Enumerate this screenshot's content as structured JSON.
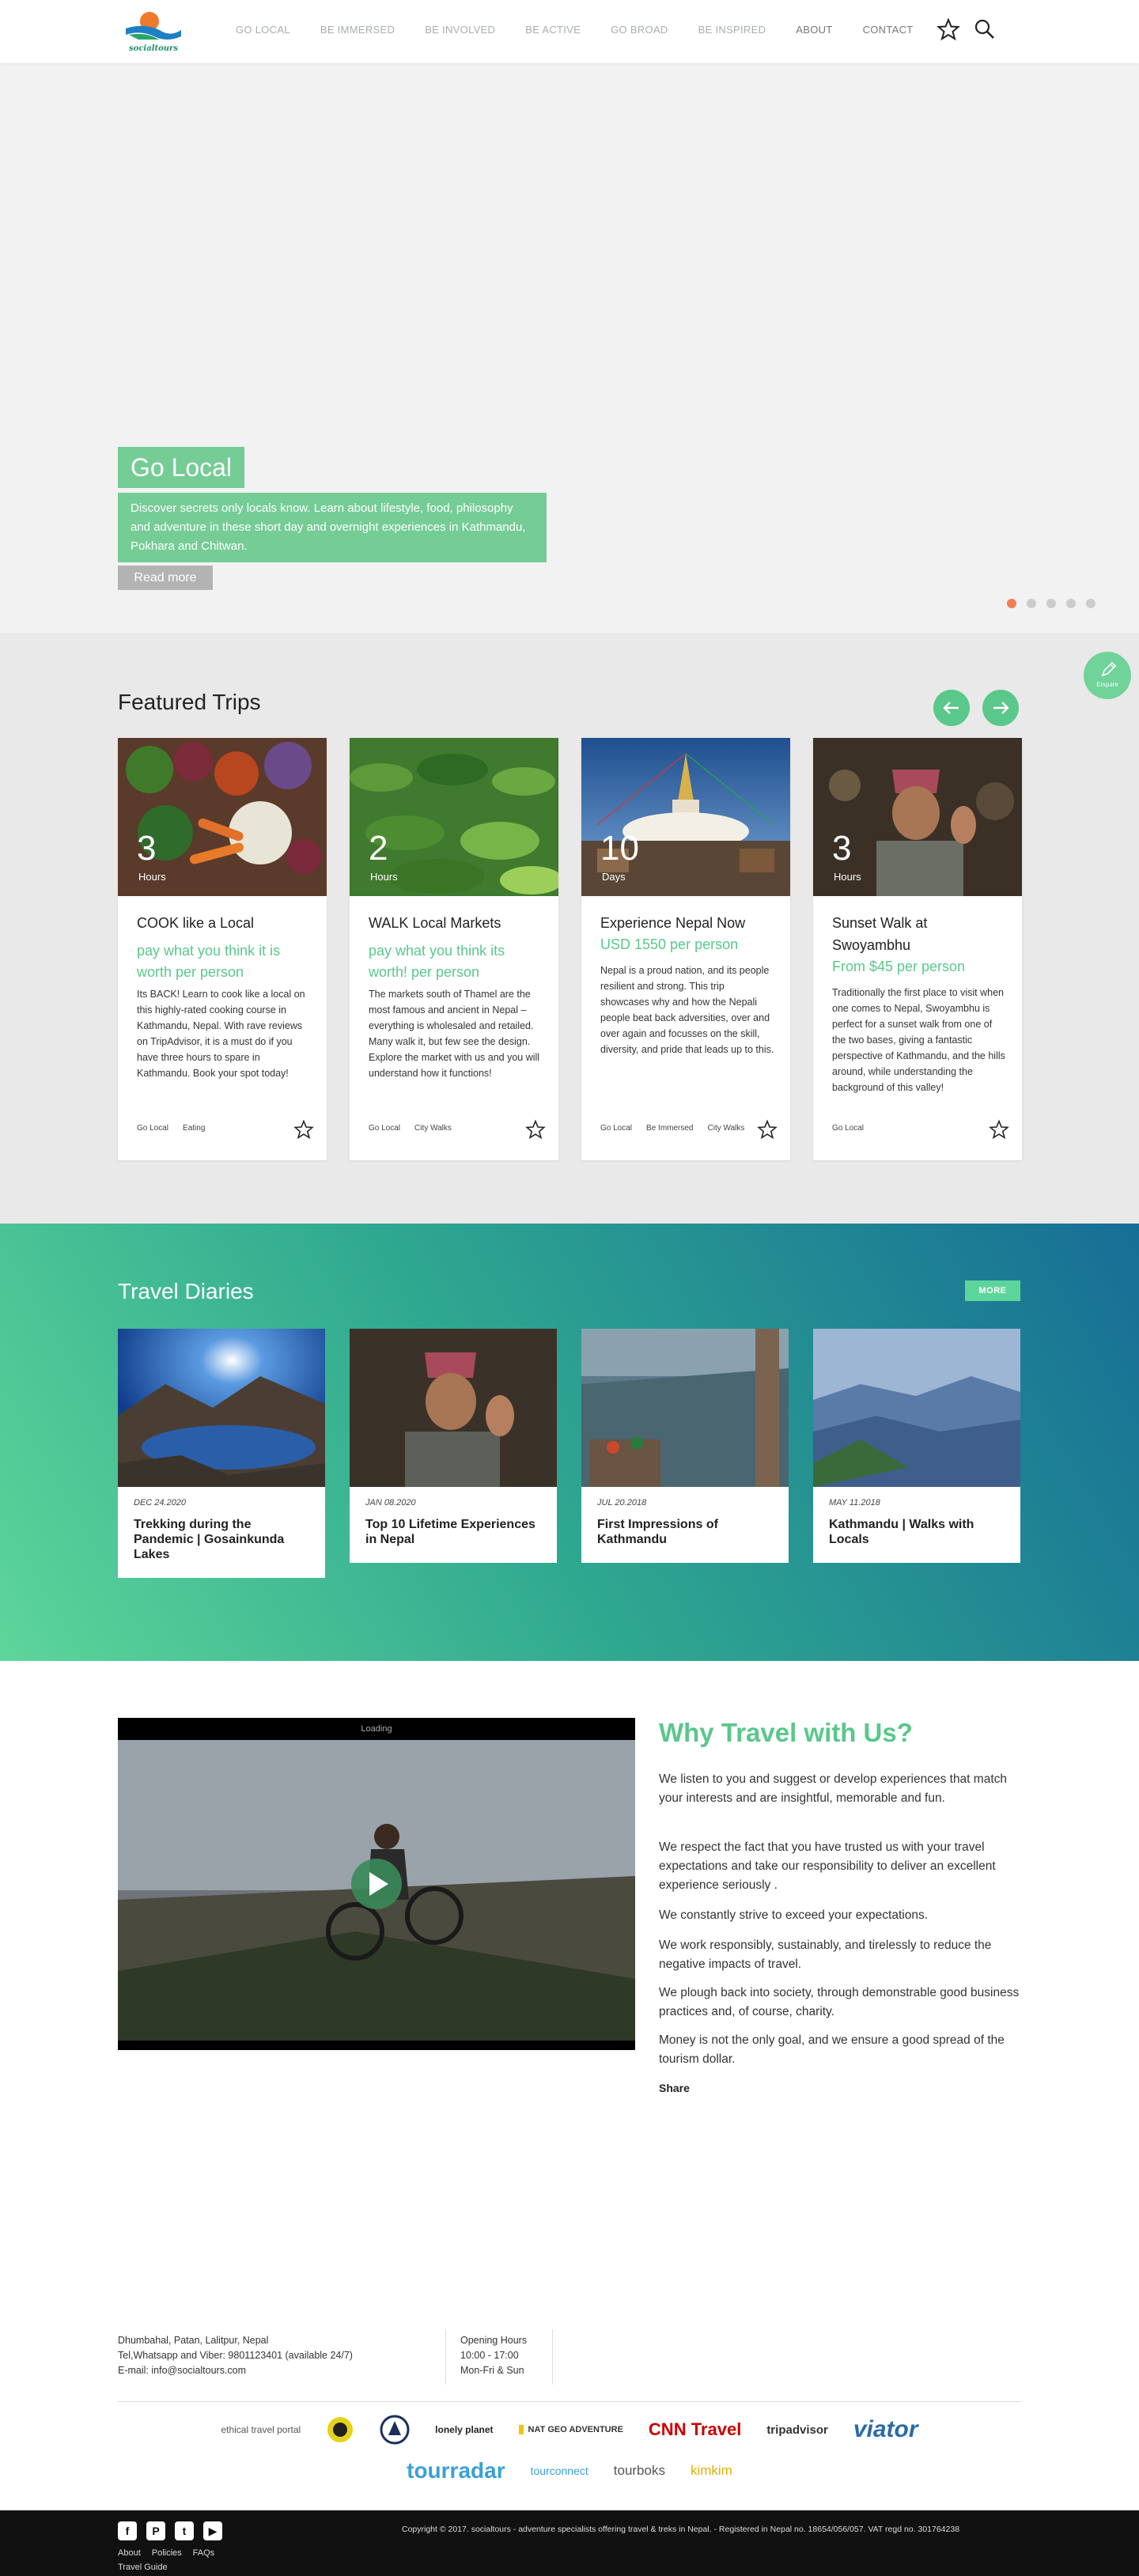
{
  "header": {
    "logo_text": "socialtours",
    "nav": [
      "GO LOCAL",
      "BE IMMERSED",
      "BE INVOLVED",
      "BE ACTIVE",
      "GO BROAD",
      "BE INSPIRED",
      "ABOUT",
      "CONTACT"
    ],
    "icons": [
      "star-icon",
      "search-icon"
    ]
  },
  "hero": {
    "title": "Go Local",
    "description": "Discover secrets only locals know. Learn about lifestyle, food, philosophy and adventure in these short day and overnight experiences in Kathmandu, Pokhara and Chitwan.",
    "button": "Read more",
    "slides": 5,
    "active_slide": 1
  },
  "enquire": {
    "label": "Enquire"
  },
  "featured": {
    "title": "Featured Trips",
    "cards": [
      {
        "duration": "3",
        "unit": "Hours",
        "title": "COOK like a Local",
        "price": "pay what you think it is worth per person",
        "text": "Its BACK! Learn to cook like a local on this highly-rated cooking course in Kathmandu, Nepal. With rave reviews on TripAdvisor, it is a must do if you have three hours to spare in Kathmandu. Book your spot today!",
        "tags": [
          "Go Local",
          "Eating"
        ]
      },
      {
        "duration": "2",
        "unit": "Hours",
        "title": "WALK Local Markets",
        "price": "pay what you think its worth! per person",
        "text": "The markets south of Thamel are the most famous and ancient in Nepal – everything is wholesaled and retailed. Many walk it, but few see the design. Explore the market with us and you will understand how it functions!",
        "tags": [
          "Go Local",
          "City Walks"
        ]
      },
      {
        "duration": "10",
        "unit": "Days",
        "title": "Experience Nepal Now",
        "price": "USD 1550 per person",
        "text": "Nepal is a proud nation, and its people resilient and strong. This trip showcases why and how the Nepali people beat back adversities, over and over again and focusses on the skill, diversity, and pride that leads up to this.",
        "tags": [
          "Go Local",
          "Be Immersed",
          "City Walks"
        ]
      },
      {
        "duration": "3",
        "unit": "Hours",
        "title": "Sunset Walk at Swoyambhu",
        "price": "From $45 per person",
        "text": "Traditionally the first place to visit when one comes to Nepal, Swoyambhu is perfect for a sunset walk from one of the two bases, giving a fantastic perspective of Kathmandu, and the hills around, while understanding the background of this valley!",
        "tags": [
          "Go Local"
        ]
      }
    ]
  },
  "diaries": {
    "title": "Travel Diaries",
    "more": "MORE",
    "posts": [
      {
        "date": "DEC 24.2020",
        "title": "Trekking during the Pandemic | Gosainkunda Lakes"
      },
      {
        "date": "JAN 08.2020",
        "title": "Top 10 Lifetime Experiences in Nepal"
      },
      {
        "date": "JUL 20.2018",
        "title": "First Impressions of Kathmandu"
      },
      {
        "date": "MAY 11.2018",
        "title": "Kathmandu | Walks with Locals"
      }
    ]
  },
  "why": {
    "video_status": "Loading",
    "title": "Why Travel with Us?",
    "paragraphs": [
      "We listen to you and suggest or develop experiences that match your interests and are insightful, memorable and fun.",
      "We respect the fact that you have trusted us with your travel expectations and take our responsibility to deliver an excellent experience seriously .",
      "We constantly strive to exceed your expectations.",
      "We work responsibly, sustainably, and tirelessly to reduce the negative impacts of travel.",
      "We plough back into society, through demonstrable good business practices and, of course, charity.",
      "Money is not the only goal, and we ensure a good spread of the tourism dollar."
    ],
    "share": "Share"
  },
  "footer": {
    "address": "Dhumbahal, Patan, Lalitpur, Nepal",
    "phone": "Tel,Whatsapp and Viber: 9801123401 (available 24/7)",
    "email": "E-mail: info@socialtours.com",
    "hours_label": "Opening Hours",
    "hours_time": "10:00 - 17:00",
    "hours_days": "Mon-Fri & Sun",
    "partners_row1": [
      "ethical travel portal",
      "",
      "",
      "lonely planet",
      "NAT GEO ADVENTURE",
      "CNN Travel",
      "tripadvisor",
      "viator"
    ],
    "partners_row2": [
      "tourradar",
      "tourconnect",
      "tourboks",
      "kimkim"
    ],
    "copyright": "Copyright © 2017. socialtours - adventure specialists offering travel & treks in Nepal. - Registered in Nepal no. 18654/056/057. VAT regd no. 301764238",
    "links": [
      "About",
      "Policies",
      "FAQs"
    ],
    "guide": "Travel Guide"
  },
  "colors": {
    "accent": "#5ac78b",
    "hero_box": "#75cc95",
    "active_dot": "#f07e52",
    "diaries_start": "#5dd59a",
    "diaries_end": "#176e96"
  }
}
